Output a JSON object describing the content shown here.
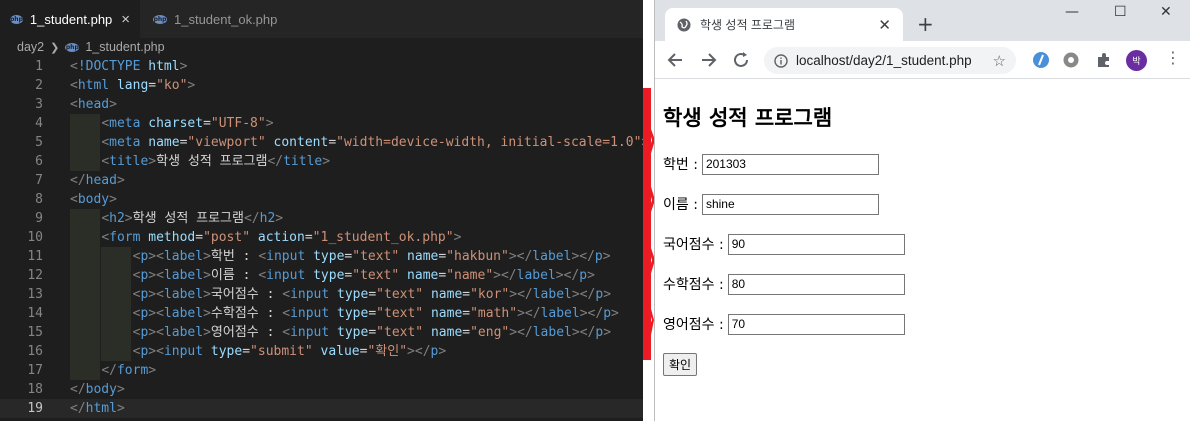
{
  "editor": {
    "tabs": [
      {
        "label": "1_student.php",
        "active": true
      },
      {
        "label": "1_student_ok.php",
        "active": false
      }
    ],
    "breadcrumb": {
      "folder": "day2",
      "file": "1_student.php"
    },
    "current_line": 19,
    "lines": [
      [
        [
          "punc",
          "<"
        ],
        [
          "tag",
          "!DOCTYPE "
        ],
        [
          "attr",
          "html"
        ],
        [
          "punc",
          ">"
        ]
      ],
      [
        [
          "punc",
          "<"
        ],
        [
          "tag",
          "html "
        ],
        [
          "attr",
          "lang"
        ],
        [
          "txt",
          "="
        ],
        [
          "str",
          "\"ko\""
        ],
        [
          "punc",
          ">"
        ]
      ],
      [
        [
          "punc",
          "<"
        ],
        [
          "tag",
          "head"
        ],
        [
          "punc",
          ">"
        ]
      ],
      [
        [
          "txt",
          "    "
        ],
        [
          "punc",
          "<"
        ],
        [
          "tag",
          "meta "
        ],
        [
          "attr",
          "charset"
        ],
        [
          "txt",
          "="
        ],
        [
          "str",
          "\"UTF-8\""
        ],
        [
          "punc",
          ">"
        ]
      ],
      [
        [
          "txt",
          "    "
        ],
        [
          "punc",
          "<"
        ],
        [
          "tag",
          "meta "
        ],
        [
          "attr",
          "name"
        ],
        [
          "txt",
          "="
        ],
        [
          "str",
          "\"viewport\""
        ],
        [
          "txt",
          " "
        ],
        [
          "attr",
          "content"
        ],
        [
          "txt",
          "="
        ],
        [
          "str",
          "\"width=device-width, initial-scale=1.0\""
        ],
        [
          "punc",
          ">"
        ]
      ],
      [
        [
          "txt",
          "    "
        ],
        [
          "punc",
          "<"
        ],
        [
          "tag",
          "title"
        ],
        [
          "punc",
          ">"
        ],
        [
          "txt",
          "학생 성적 프로그램"
        ],
        [
          "punc",
          "</"
        ],
        [
          "tag",
          "title"
        ],
        [
          "punc",
          ">"
        ]
      ],
      [
        [
          "punc",
          "</"
        ],
        [
          "tag",
          "head"
        ],
        [
          "punc",
          ">"
        ]
      ],
      [
        [
          "punc",
          "<"
        ],
        [
          "tag",
          "body"
        ],
        [
          "punc",
          ">"
        ]
      ],
      [
        [
          "txt",
          "    "
        ],
        [
          "punc",
          "<"
        ],
        [
          "tag",
          "h2"
        ],
        [
          "punc",
          ">"
        ],
        [
          "txt",
          "학생 성적 프로그램"
        ],
        [
          "punc",
          "</"
        ],
        [
          "tag",
          "h2"
        ],
        [
          "punc",
          ">"
        ]
      ],
      [
        [
          "txt",
          "    "
        ],
        [
          "punc",
          "<"
        ],
        [
          "tag",
          "form "
        ],
        [
          "attr",
          "method"
        ],
        [
          "txt",
          "="
        ],
        [
          "str",
          "\"post\""
        ],
        [
          "txt",
          " "
        ],
        [
          "attr",
          "action"
        ],
        [
          "txt",
          "="
        ],
        [
          "str",
          "\"1_student_ok.php\""
        ],
        [
          "punc",
          ">"
        ]
      ],
      [
        [
          "txt",
          "        "
        ],
        [
          "punc",
          "<"
        ],
        [
          "tag",
          "p"
        ],
        [
          "punc",
          "><"
        ],
        [
          "tag",
          "label"
        ],
        [
          "punc",
          ">"
        ],
        [
          "txt",
          "학번 : "
        ],
        [
          "punc",
          "<"
        ],
        [
          "tag",
          "input "
        ],
        [
          "attr",
          "type"
        ],
        [
          "txt",
          "="
        ],
        [
          "str",
          "\"text\""
        ],
        [
          "txt",
          " "
        ],
        [
          "attr",
          "name"
        ],
        [
          "txt",
          "="
        ],
        [
          "str",
          "\"hakbun\""
        ],
        [
          "punc",
          "></"
        ],
        [
          "tag",
          "label"
        ],
        [
          "punc",
          "></"
        ],
        [
          "tag",
          "p"
        ],
        [
          "punc",
          ">"
        ]
      ],
      [
        [
          "txt",
          "        "
        ],
        [
          "punc",
          "<"
        ],
        [
          "tag",
          "p"
        ],
        [
          "punc",
          "><"
        ],
        [
          "tag",
          "label"
        ],
        [
          "punc",
          ">"
        ],
        [
          "txt",
          "이름 : "
        ],
        [
          "punc",
          "<"
        ],
        [
          "tag",
          "input "
        ],
        [
          "attr",
          "type"
        ],
        [
          "txt",
          "="
        ],
        [
          "str",
          "\"text\""
        ],
        [
          "txt",
          " "
        ],
        [
          "attr",
          "name"
        ],
        [
          "txt",
          "="
        ],
        [
          "str",
          "\"name\""
        ],
        [
          "punc",
          "></"
        ],
        [
          "tag",
          "label"
        ],
        [
          "punc",
          "></"
        ],
        [
          "tag",
          "p"
        ],
        [
          "punc",
          ">"
        ]
      ],
      [
        [
          "txt",
          "        "
        ],
        [
          "punc",
          "<"
        ],
        [
          "tag",
          "p"
        ],
        [
          "punc",
          "><"
        ],
        [
          "tag",
          "label"
        ],
        [
          "punc",
          ">"
        ],
        [
          "txt",
          "국어점수 : "
        ],
        [
          "punc",
          "<"
        ],
        [
          "tag",
          "input "
        ],
        [
          "attr",
          "type"
        ],
        [
          "txt",
          "="
        ],
        [
          "str",
          "\"text\""
        ],
        [
          "txt",
          " "
        ],
        [
          "attr",
          "name"
        ],
        [
          "txt",
          "="
        ],
        [
          "str",
          "\"kor\""
        ],
        [
          "punc",
          "></"
        ],
        [
          "tag",
          "label"
        ],
        [
          "punc",
          "></"
        ],
        [
          "tag",
          "p"
        ],
        [
          "punc",
          ">"
        ]
      ],
      [
        [
          "txt",
          "        "
        ],
        [
          "punc",
          "<"
        ],
        [
          "tag",
          "p"
        ],
        [
          "punc",
          "><"
        ],
        [
          "tag",
          "label"
        ],
        [
          "punc",
          ">"
        ],
        [
          "txt",
          "수학점수 : "
        ],
        [
          "punc",
          "<"
        ],
        [
          "tag",
          "input "
        ],
        [
          "attr",
          "type"
        ],
        [
          "txt",
          "="
        ],
        [
          "str",
          "\"text\""
        ],
        [
          "txt",
          " "
        ],
        [
          "attr",
          "name"
        ],
        [
          "txt",
          "="
        ],
        [
          "str",
          "\"math\""
        ],
        [
          "punc",
          "></"
        ],
        [
          "tag",
          "label"
        ],
        [
          "punc",
          "></"
        ],
        [
          "tag",
          "p"
        ],
        [
          "punc",
          ">"
        ]
      ],
      [
        [
          "txt",
          "        "
        ],
        [
          "punc",
          "<"
        ],
        [
          "tag",
          "p"
        ],
        [
          "punc",
          "><"
        ],
        [
          "tag",
          "label"
        ],
        [
          "punc",
          ">"
        ],
        [
          "txt",
          "영어점수 : "
        ],
        [
          "punc",
          "<"
        ],
        [
          "tag",
          "input "
        ],
        [
          "attr",
          "type"
        ],
        [
          "txt",
          "="
        ],
        [
          "str",
          "\"text\""
        ],
        [
          "txt",
          " "
        ],
        [
          "attr",
          "name"
        ],
        [
          "txt",
          "="
        ],
        [
          "str",
          "\"eng\""
        ],
        [
          "punc",
          "></"
        ],
        [
          "tag",
          "label"
        ],
        [
          "punc",
          "></"
        ],
        [
          "tag",
          "p"
        ],
        [
          "punc",
          ">"
        ]
      ],
      [
        [
          "txt",
          "        "
        ],
        [
          "punc",
          "<"
        ],
        [
          "tag",
          "p"
        ],
        [
          "punc",
          "><"
        ],
        [
          "tag",
          "input "
        ],
        [
          "attr",
          "type"
        ],
        [
          "txt",
          "="
        ],
        [
          "str",
          "\"submit\""
        ],
        [
          "txt",
          " "
        ],
        [
          "attr",
          "value"
        ],
        [
          "txt",
          "="
        ],
        [
          "str",
          "\"확인\""
        ],
        [
          "punc",
          "></"
        ],
        [
          "tag",
          "p"
        ],
        [
          "punc",
          ">"
        ]
      ],
      [
        [
          "txt",
          "    "
        ],
        [
          "punc",
          "</"
        ],
        [
          "tag",
          "form"
        ],
        [
          "punc",
          ">"
        ]
      ],
      [
        [
          "punc",
          "</"
        ],
        [
          "tag",
          "body"
        ],
        [
          "punc",
          ">"
        ]
      ],
      [
        [
          "punc",
          "</"
        ],
        [
          "tag",
          "html"
        ],
        [
          "punc",
          ">"
        ]
      ]
    ]
  },
  "browser": {
    "tab_title": "학생 성적 프로그램",
    "new_tab": "+",
    "address": "localhost/day2/1_student.php",
    "avatar_initial": "박",
    "page": {
      "heading": "학생 성적 프로그램",
      "fields": [
        {
          "label": "학번 :",
          "value": "201303"
        },
        {
          "label": "이름 :",
          "value": "shine"
        },
        {
          "label": "국어점수 :",
          "value": "90"
        },
        {
          "label": "수학점수 :",
          "value": "80"
        },
        {
          "label": "영어점수 :",
          "value": "70"
        }
      ],
      "submit_label": "확인"
    }
  },
  "colors": {
    "divider_red": "#ed1c24",
    "editor_bg": "#1e1e1e",
    "tag": "#569cd6",
    "attr": "#9cdcfe",
    "string": "#ce9178"
  }
}
